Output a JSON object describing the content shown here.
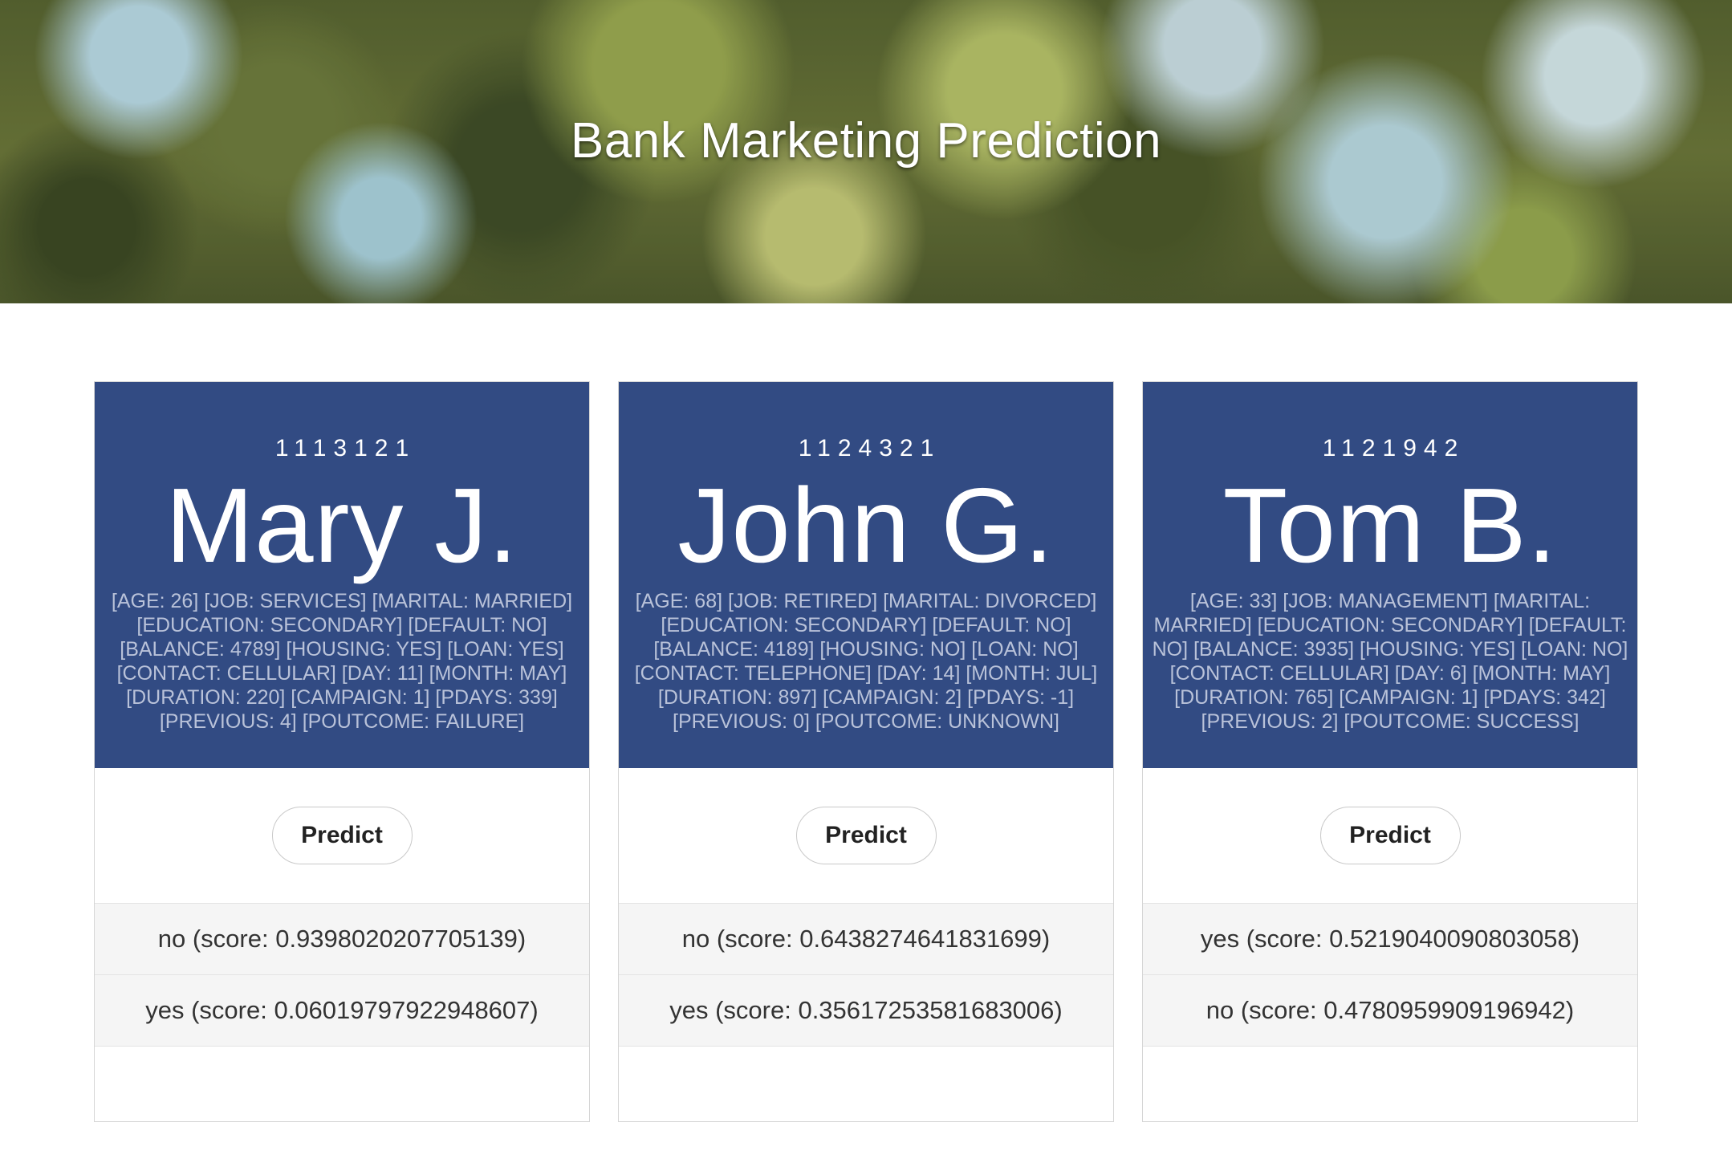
{
  "header": {
    "title": "Bank Marketing Prediction"
  },
  "cards": [
    {
      "id": "1113121",
      "name": "Mary J.",
      "description": "[AGE: 26] [JOB: SERVICES] [MARITAL: MARRIED] [EDUCATION: SECONDARY] [DEFAULT: NO] [BALANCE: 4789] [HOUSING: YES] [LOAN: YES] [CONTACT: CELLULAR] [DAY: 11] [MONTH: MAY] [DURATION: 220] [CAMPAIGN: 1] [PDAYS: 339] [PREVIOUS: 4] [POUTCOME: FAILURE]",
      "predict_label": "Predict",
      "results": [
        "no (score: 0.9398020207705139)",
        "yes (score: 0.06019797922948607)"
      ]
    },
    {
      "id": "1124321",
      "name": "John G.",
      "description": "[AGE: 68] [JOB: RETIRED] [MARITAL: DIVORCED] [EDUCATION: SECONDARY] [DEFAULT: NO] [BALANCE: 4189] [HOUSING: NO] [LOAN: NO] [CONTACT: TELEPHONE] [DAY: 14] [MONTH: JUL] [DURATION: 897] [CAMPAIGN: 2] [PDAYS: -1] [PREVIOUS: 0] [POUTCOME: UNKNOWN]",
      "predict_label": "Predict",
      "results": [
        "no (score: 0.6438274641831699)",
        "yes (score: 0.35617253581683006)"
      ]
    },
    {
      "id": "1121942",
      "name": "Tom B.",
      "description": "[AGE: 33] [JOB: MANAGEMENT] [MARITAL: MARRIED] [EDUCATION: SECONDARY] [DEFAULT: NO] [BALANCE: 3935] [HOUSING: YES] [LOAN: NO] [CONTACT: CELLULAR] [DAY: 6] [MONTH: MAY] [DURATION: 765] [CAMPAIGN: 1] [PDAYS: 342] [PREVIOUS: 2] [POUTCOME: SUCCESS]",
      "predict_label": "Predict",
      "results": [
        "yes (score: 0.5219040090803058)",
        "no (score: 0.4780959909196942)"
      ]
    }
  ],
  "colors": {
    "card_header": "#324b83",
    "description_text": "#b9c2d9",
    "result_background": "#f5f5f5"
  }
}
